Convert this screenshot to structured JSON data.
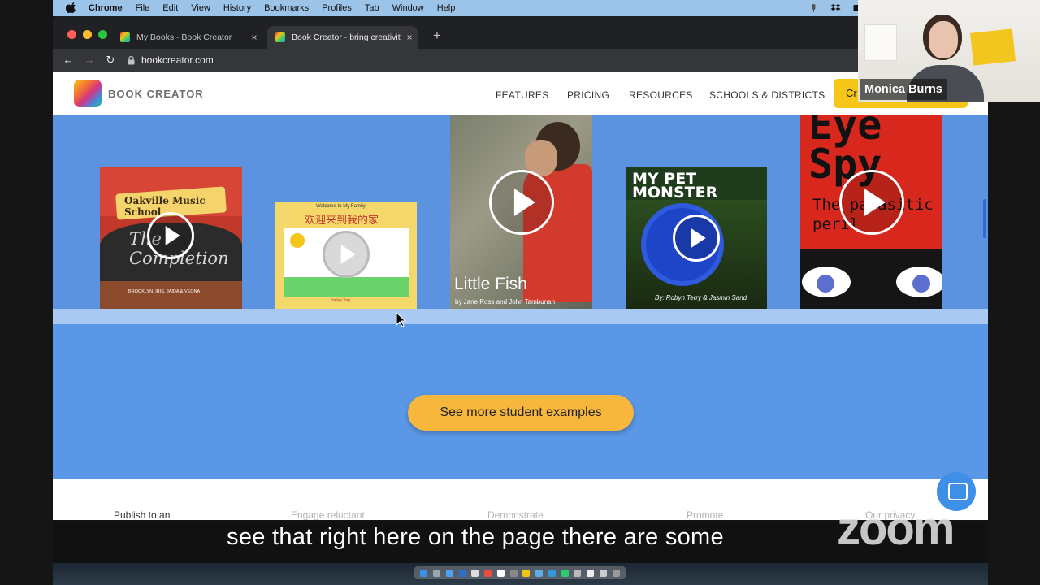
{
  "menubar": {
    "items": [
      "Chrome",
      "File",
      "Edit",
      "View",
      "History",
      "Bookmarks",
      "Profiles",
      "Tab",
      "Window",
      "Help"
    ]
  },
  "tabs": [
    {
      "title": "My Books - Book Creator",
      "close": "×"
    },
    {
      "title": "Book Creator - bring creativity",
      "close": "×"
    }
  ],
  "new_tab": "+",
  "address": "bookcreator.com",
  "site": {
    "logo_text": "BOOK CREATOR",
    "nav": [
      "FEATURES",
      "PRICING",
      "RESOURCES",
      "SCHOOLS & DISTRICTS"
    ],
    "cta": "Cr"
  },
  "books": [
    {
      "title": "Oakville Music School",
      "subtitle": "The Completion",
      "byline": "BROOKLYN, IRIS, JAIDA & VEONA"
    },
    {
      "title": "Welcome to My Family",
      "title_cn": "欢迎来到我的家",
      "byline": "Hailey Yap"
    },
    {
      "title": "Little Fish",
      "byline": "by Jane Ross and John Tambunan"
    },
    {
      "title": "MY PET MONSTER",
      "byline": "By: Robyn Terry & Jasmin Sand"
    },
    {
      "title": "Eye Spy",
      "subtitle": "The parasitic peril"
    }
  ],
  "more_button": "See more student examples",
  "bottom_row": [
    {
      "text": "Publish to an",
      "faded": false
    },
    {
      "text": "Engage reluctant",
      "faded": true
    },
    {
      "text": "Demonstrate",
      "faded": true
    },
    {
      "text": "Promote",
      "faded": true
    },
    {
      "text": "Our privacy",
      "faded": true
    }
  ],
  "participant_name": "Monica Burns",
  "caption": "see that right here on the page there are some",
  "zoom_logo": "zoom",
  "colors": {
    "menubar": "#9cc3e8",
    "site_blue": "#5a97e6",
    "cta_yellow": "#f5c518",
    "button_orange": "#f6b73c"
  }
}
